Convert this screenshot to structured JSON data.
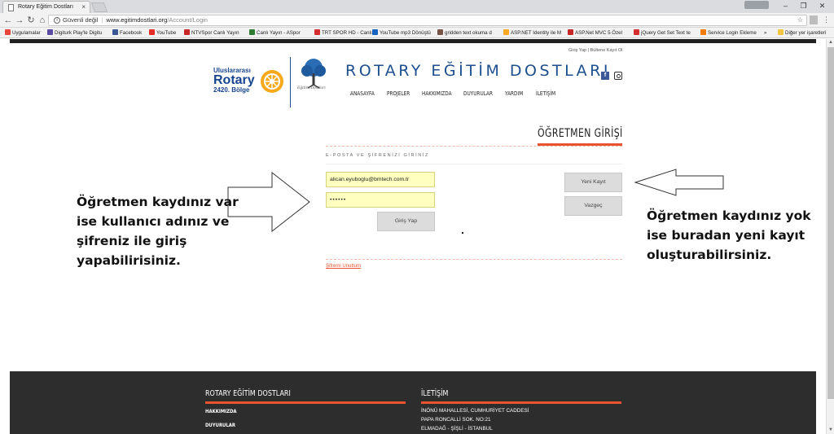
{
  "browser": {
    "tab_title": "Rotary Eğitim Dostları",
    "security_label": "Güvenli değil",
    "url_host": "www.egitimdostlari.org",
    "url_path": "/Account/Login",
    "bookmarks": [
      {
        "label": "Uygulamalar",
        "color": "#e8453c"
      },
      {
        "label": "Digiturk Play'le Digitu",
        "color": "#5b4aa6"
      },
      {
        "label": "Facebook",
        "color": "#3b5998"
      },
      {
        "label": "YouTube",
        "color": "#e52d27"
      },
      {
        "label": "NTVSpor Canlı Yayın",
        "color": "#c62828"
      },
      {
        "label": "Canlı Yayın - ASpor",
        "color": "#2e7d32"
      },
      {
        "label": "TRT SPOR HD - Canlı",
        "color": "#d32f2f"
      },
      {
        "label": "YouTube mp3 Dönüştü",
        "color": "#1565c0"
      },
      {
        "label": "gridden text okuma d",
        "color": "#795548"
      },
      {
        "label": "ASP.NET Identity ile M",
        "color": "#f9a825"
      },
      {
        "label": "ASP.Net MVC 5 Özel",
        "color": "#c62828"
      },
      {
        "label": "jQuery Get Set Text te",
        "color": "#d32f2f"
      },
      {
        "label": "Service Login Ekleme",
        "color": "#f57c00"
      }
    ],
    "bookmarks_more": "»",
    "other_bookmarks": "Diğer yer işaretleri"
  },
  "site": {
    "top_links": "Giriş Yap | Bültene Kayıt Ol",
    "rotary_line1": "Uluslararası",
    "rotary_line2": "Rotary",
    "rotary_line3": "2420. Bölge",
    "tree_caption": "Eğitim Dostları",
    "title": "ROTARY EĞİTİM DOSTLARI",
    "social_fb": "f",
    "nav": [
      "ANASAYFA",
      "PROJELER",
      "HAKKIMIZDA",
      "DUYURULAR",
      "YARDIM",
      "İLETİŞİM"
    ]
  },
  "login": {
    "title": "ÖĞRETMEN GİRİŞİ",
    "subtitle": "E-POSTA VE ŞİFRENİZİ GİRİNİZ",
    "email_value": "alican.eyuboglu@bmtech.com.tr",
    "password_value": "••••••",
    "login_button": "Giriş Yap",
    "new_register_button": "Yeni Kayıt",
    "cancel_button": "Vazgeç",
    "forgot_link": "Şifremi Unuttum"
  },
  "annotations": {
    "left": [
      "Öğretmen kaydınız var",
      "ise kullanıcı adınız ve",
      "şifreniz ile giriş",
      "yapabilirisiniz."
    ],
    "right": [
      "Öğretmen kaydınız yok",
      "ise buradan yeni kayıt",
      "oluşturabilirsiniz."
    ]
  },
  "footer": {
    "col1_title": "ROTARY EĞİTİM DOSTLARI",
    "col1_links": [
      "HAKKIMIZDA",
      "DUYURULAR"
    ],
    "col2_title": "İLETİŞİM",
    "col2_lines": [
      "İNÖNÜ MAHALLESİ, CUMHURİYET CADDESİ",
      "PAPA RONCALLİ SOK. NO:21",
      "ELMADAĞ - ŞİŞLİ - İSTANBUL"
    ]
  },
  "colors": {
    "accent": "#e8542f",
    "brand_blue": "#1d4f8f",
    "field_bg": "#ffffbf",
    "footer_bg": "#2d2d2d"
  }
}
